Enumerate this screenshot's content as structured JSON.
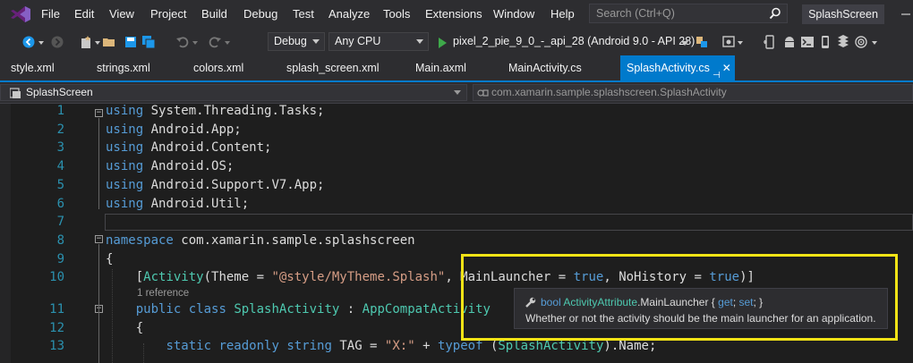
{
  "menu": [
    "File",
    "Edit",
    "View",
    "Project",
    "Build",
    "Debug",
    "Test",
    "Analyze",
    "Tools",
    "Extensions",
    "Window",
    "Help"
  ],
  "search": {
    "placeholder": "Search (Ctrl+Q)"
  },
  "solution_name": "SplashScreen",
  "toolbar": {
    "config": "Debug",
    "platform": "Any CPU",
    "run_target": "pixel_2_pie_9_0_-_api_28 (Android 9.0 - API 28)"
  },
  "tabs": [
    "style.xml",
    "strings.xml",
    "colors.xml",
    "splash_screen.xml",
    "Main.axml",
    "MainActivity.cs",
    "SplashActivity.cs"
  ],
  "nav": {
    "project": "SplashScreen",
    "member": "com.xamarin.sample.splashscreen.SplashActivity"
  },
  "editor": {
    "line_numbers": [
      "1",
      "2",
      "3",
      "4",
      "5",
      "6",
      "7",
      "8",
      "9",
      "10",
      "11",
      "12",
      "13"
    ],
    "lines": [
      [
        [
          "kw",
          "using"
        ],
        [
          "pr",
          " System.Threading.Tasks;"
        ]
      ],
      [
        [
          "kw",
          "using"
        ],
        [
          "pr",
          " Android.App;"
        ]
      ],
      [
        [
          "kw",
          "using"
        ],
        [
          "pr",
          " Android.Content;"
        ]
      ],
      [
        [
          "kw",
          "using"
        ],
        [
          "pr",
          " Android.OS;"
        ]
      ],
      [
        [
          "kw",
          "using"
        ],
        [
          "pr",
          " Android.Support.V7.App;"
        ]
      ],
      [
        [
          "kw",
          "using"
        ],
        [
          "pr",
          " Android.Util;"
        ]
      ],
      [],
      [
        [
          "kw",
          "namespace"
        ],
        [
          "pr",
          " com.xamarin.sample.splashscreen"
        ]
      ],
      [
        [
          "pr",
          "{"
        ]
      ],
      [
        [
          "pr",
          "    ["
        ],
        [
          "ty",
          "Activity"
        ],
        [
          "pr",
          "(Theme = "
        ],
        [
          "st",
          "\"@style/MyTheme.Splash\""
        ],
        [
          "pr",
          ", MainLauncher = "
        ],
        [
          "kw",
          "true"
        ],
        [
          "pr",
          ", NoHistory = "
        ],
        [
          "kw",
          "true"
        ],
        [
          "pr",
          ")]"
        ]
      ],
      [
        [
          "pr",
          "    "
        ],
        [
          "kw",
          "public"
        ],
        [
          "pr",
          " "
        ],
        [
          "kw",
          "class"
        ],
        [
          "pr",
          " "
        ],
        [
          "ty",
          "SplashActivity"
        ],
        [
          "pr",
          " : "
        ],
        [
          "ty",
          "AppCompatActivity"
        ]
      ],
      [
        [
          "pr",
          "    {"
        ]
      ],
      [
        [
          "pr",
          "        "
        ],
        [
          "kw",
          "static"
        ],
        [
          "pr",
          " "
        ],
        [
          "kw",
          "readonly"
        ],
        [
          "pr",
          " "
        ],
        [
          "kw",
          "string"
        ],
        [
          "pr",
          " TAG = "
        ],
        [
          "st",
          "\"X:\""
        ],
        [
          "pr",
          " + "
        ],
        [
          "kw",
          "typeof"
        ],
        [
          "pr",
          " ("
        ],
        [
          "ty",
          "SplashActivity"
        ],
        [
          "pr",
          ").Name;"
        ]
      ]
    ],
    "codelens": "1 reference"
  },
  "tooltip": {
    "type": "bool",
    "owner": "ActivityAttribute",
    "member": ".MainLauncher",
    "accessors_open": " { ",
    "get": "get",
    "sep": "; ",
    "set": "set",
    "accessors_close": "; }",
    "description": "Whether or not the activity should be the main launcher for an application."
  },
  "colors": {
    "accent": "#007acc",
    "highlight": "#f2e316"
  }
}
